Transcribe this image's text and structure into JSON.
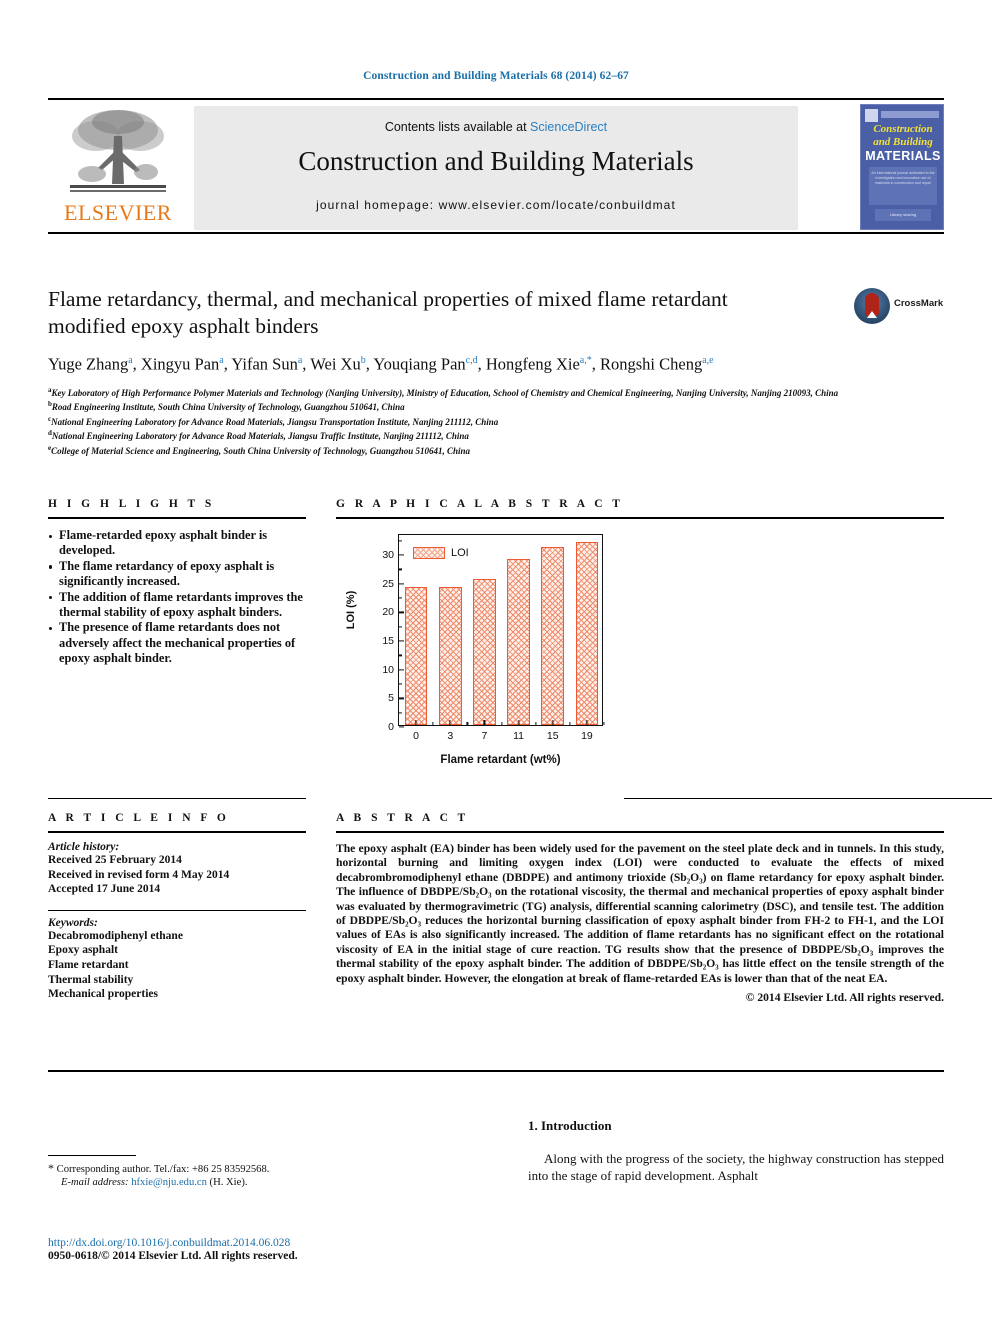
{
  "running_head": "Construction and Building Materials 68 (2014) 62–67",
  "masthead": {
    "publisher": "ELSEVIER",
    "contents_prefix": "Contents lists available at ",
    "contents_link": "ScienceDirect",
    "journal_title": "Construction and Building Materials",
    "homepage": "journal homepage: www.elsevier.com/locate/conbuildmat",
    "cover": {
      "line1": "Construction",
      "line2": "and Building",
      "line3": "MATERIALS",
      "blurb": "An international journal dedicated to the investigation and innovative use of materials in construction and repair",
      "footer": "Library sharing"
    }
  },
  "article": {
    "title": "Flame retardancy, thermal, and mechanical properties of mixed flame retardant modified epoxy asphalt binders",
    "crossmark_label": "CrossMark",
    "authors": [
      {
        "name": "Yuge Zhang",
        "sup": "a",
        "sep": ", "
      },
      {
        "name": "Xingyu Pan",
        "sup": "a",
        "sep": ", "
      },
      {
        "name": "Yifan Sun",
        "sup": "a",
        "sep": ", "
      },
      {
        "name": "Wei Xu",
        "sup": "b",
        "sep": ", "
      },
      {
        "name": "Youqiang Pan",
        "sup": "c,d",
        "sep": ", "
      },
      {
        "name": "Hongfeng Xie",
        "sup": "a,*",
        "sep": ", "
      },
      {
        "name": "Rongshi Cheng",
        "sup": "a,e",
        "sep": ""
      }
    ],
    "affiliations": [
      {
        "marker": "a",
        "text": "Key Laboratory of High Performance Polymer Materials and Technology (Nanjing University), Ministry of Education, School of Chemistry and Chemical Engineering, Nanjing University, Nanjing 210093, China"
      },
      {
        "marker": "b",
        "text": "Road Engineering Institute, South China University of Technology, Guangzhou 510641, China"
      },
      {
        "marker": "c",
        "text": "National Engineering Laboratory for Advance Road Materials, Jiangsu Transportation Institute, Nanjing 211112, China"
      },
      {
        "marker": "d",
        "text": "National Engineering Laboratory for Advance Road Materials, Jiangsu Traffic Institute, Nanjing 211112, China"
      },
      {
        "marker": "e",
        "text": "College of Material Science and Engineering, South China University of Technology, Guangzhou 510641, China"
      }
    ]
  },
  "highlights": {
    "heading": "H I G H L I G H T S",
    "items": [
      "Flame-retarded epoxy asphalt binder is developed.",
      "The flame retardancy of epoxy asphalt is significantly increased.",
      "The addition of flame retardants improves the thermal stability of epoxy asphalt binders.",
      "The presence of flame retardants does not adversely affect the mechanical properties of epoxy asphalt binder."
    ]
  },
  "graphical_abstract": {
    "heading": "G R A P H I C A L   A B S T R A C T"
  },
  "chart_data": {
    "type": "bar",
    "title": "",
    "categories": [
      "0",
      "3",
      "7",
      "11",
      "15",
      "19"
    ],
    "values": [
      24,
      24,
      25.4,
      29,
      31,
      32
    ],
    "series": [
      {
        "name": "LOI",
        "values": [
          24,
          24,
          25.4,
          29,
          31,
          32
        ]
      }
    ],
    "legend": [
      "LOI"
    ],
    "legend_position": "top-left",
    "xlabel": "Flame retardant (wt%)",
    "ylabel": "LOI (%)",
    "ylim": [
      0,
      33.5
    ],
    "yticks": [
      0,
      5,
      10,
      15,
      20,
      25,
      30
    ],
    "grid": false,
    "bar_color": "#ef5a32",
    "bar_fill": "#fdf0eb"
  },
  "article_info": {
    "heading": "A R T I C L E   I N F O",
    "history_label": "Article history:",
    "history": [
      "Received 25 February 2014",
      "Received in revised form 4 May 2014",
      "Accepted 17 June 2014"
    ],
    "keywords_label": "Keywords:",
    "keywords": [
      "Decabromodiphenyl ethane",
      "Epoxy asphalt",
      "Flame retardant",
      "Thermal stability",
      "Mechanical properties"
    ]
  },
  "abstract": {
    "heading": "A B S T R A C T",
    "text": "The epoxy asphalt (EA) binder has been widely used for the pavement on the steel plate deck and in tunnels. In this study, horizontal burning and limiting oxygen index (LOI) were conducted to evaluate the effects of mixed decabrombromodiphenyl ethane (DBDPE) and antimony trioxide (Sb₂O₃) on flame retardancy for epoxy asphalt binder. The influence of DBDPE/Sb₂O₃ on the rotational viscosity, the thermal and mechanical properties of epoxy asphalt binder was evaluated by thermogravimetric (TG) analysis, differential scanning calorimetry (DSC), and tensile test. The addition of DBDPE/Sb₂O₃ reduces the horizontal burning classification of epoxy asphalt binder from FH-2 to FH-1, and the LOI values of EAs is also significantly increased. The addition of flame retardants has no significant effect on the rotational viscosity of EA in the initial stage of cure reaction. TG results show that the presence of DBDPE/Sb₂O₃ improves the thermal stability of the epoxy asphalt binder. The addition of DBDPE/Sb₂O₃ has little effect on the tensile strength of the epoxy asphalt binder. However, the elongation at break of flame-retarded EAs is lower than that of the neat EA.",
    "copyright": "© 2014 Elsevier Ltd. All rights reserved."
  },
  "introduction": {
    "heading": "1. Introduction",
    "paragraph": "Along with the progress of the society, the highway construction has stepped into the stage of rapid development. Asphalt"
  },
  "footnotes": {
    "corresponding": "Corresponding author. Tel./fax: +86 25 83592568.",
    "email_label": "E-mail address:",
    "email": "hfxie@nju.edu.cn",
    "email_suffix": "(H. Xie)."
  },
  "footer": {
    "doi": "http://dx.doi.org/10.1016/j.conbuildmat.2014.06.028",
    "issn": "0950-0618/© 2014 Elsevier Ltd. All rights reserved."
  }
}
